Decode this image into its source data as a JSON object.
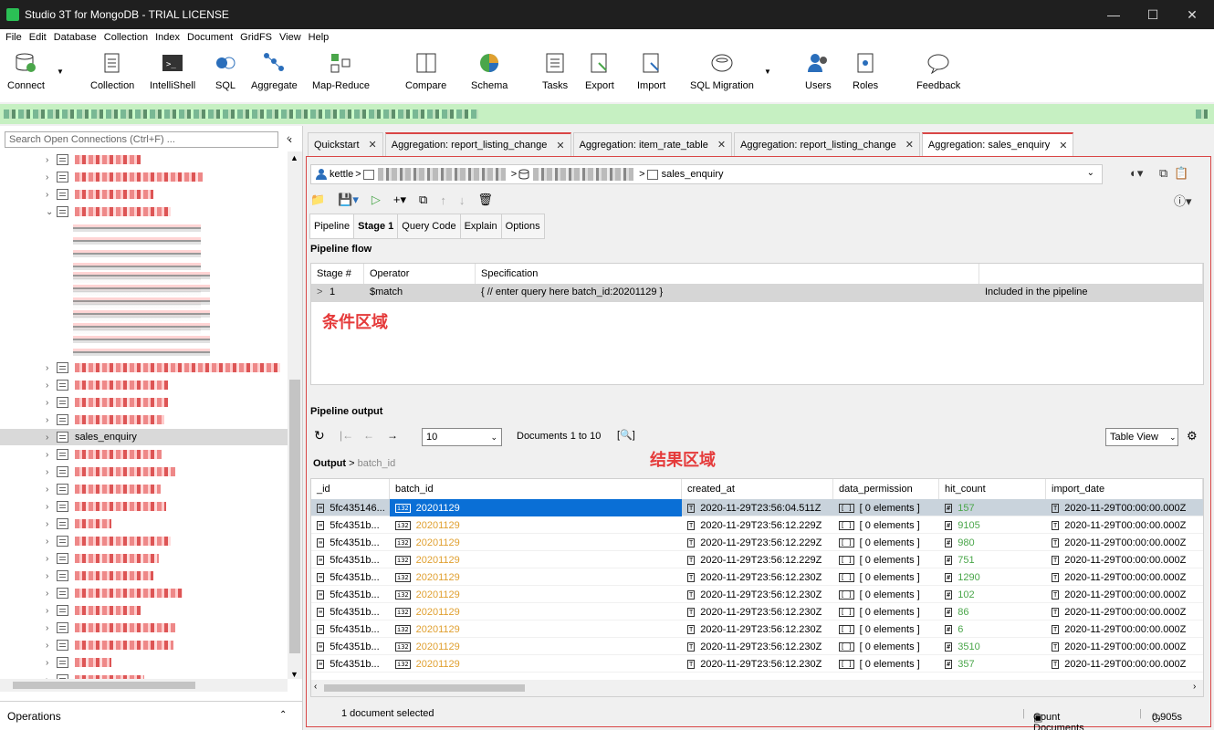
{
  "window": {
    "title": "Studio 3T for MongoDB - TRIAL LICENSE"
  },
  "menu": [
    "File",
    "Edit",
    "Database",
    "Collection",
    "Index",
    "Document",
    "GridFS",
    "View",
    "Help"
  ],
  "toolbar": [
    "Connect",
    "Collection",
    "IntelliShell",
    "SQL",
    "Aggregate",
    "Map-Reduce",
    "Compare",
    "Schema",
    "Tasks",
    "Export",
    "Import",
    "SQL Migration",
    "Users",
    "Roles",
    "Feedback"
  ],
  "left": {
    "search_placeholder": "Search Open Connections (Ctrl+F) ...",
    "selected_item": "sales_enquiry",
    "operations_label": "Operations"
  },
  "tabs": [
    "Quickstart",
    "Aggregation: report_listing_change",
    "Aggregation: item_rate_table",
    "Aggregation: report_listing_change",
    "Aggregation: sales_enquiry"
  ],
  "breadcrumb": {
    "user": "kettle",
    "collection": "sales_enquiry"
  },
  "subtabs": [
    "Pipeline",
    "Stage 1",
    "Query Code",
    "Explain",
    "Options"
  ],
  "pipeline_flow": {
    "heading": "Pipeline flow",
    "columns": [
      "Stage #",
      "Operator",
      "Specification"
    ],
    "row": {
      "stage": "1",
      "operator": "$match",
      "spec": "{ // enter query here batch_id:20201129 }",
      "status": "Included in the pipeline"
    },
    "annotation": "条件区域"
  },
  "pipeline_output": {
    "heading": "Pipeline output",
    "page_size": "10",
    "documents_label": "Documents 1 to 10",
    "view": "Table View",
    "annotation": "结果区域",
    "crumb_output": "Output",
    "crumb_field": "batch_id",
    "columns": [
      "_id",
      "batch_id",
      "created_at",
      "data_permission",
      "hit_count",
      "import_date"
    ],
    "rows": [
      {
        "id": "5fc435146...",
        "batch": "20201129",
        "created": "2020-11-29T23:56:04.511Z",
        "perm": "[ 0 elements ]",
        "hits": "157",
        "import": "2020-11-29T00:00:00.000Z"
      },
      {
        "id": "5fc4351b...",
        "batch": "20201129",
        "created": "2020-11-29T23:56:12.229Z",
        "perm": "[ 0 elements ]",
        "hits": "9105",
        "import": "2020-11-29T00:00:00.000Z"
      },
      {
        "id": "5fc4351b...",
        "batch": "20201129",
        "created": "2020-11-29T23:56:12.229Z",
        "perm": "[ 0 elements ]",
        "hits": "980",
        "import": "2020-11-29T00:00:00.000Z"
      },
      {
        "id": "5fc4351b...",
        "batch": "20201129",
        "created": "2020-11-29T23:56:12.229Z",
        "perm": "[ 0 elements ]",
        "hits": "751",
        "import": "2020-11-29T00:00:00.000Z"
      },
      {
        "id": "5fc4351b...",
        "batch": "20201129",
        "created": "2020-11-29T23:56:12.230Z",
        "perm": "[ 0 elements ]",
        "hits": "1290",
        "import": "2020-11-29T00:00:00.000Z"
      },
      {
        "id": "5fc4351b...",
        "batch": "20201129",
        "created": "2020-11-29T23:56:12.230Z",
        "perm": "[ 0 elements ]",
        "hits": "102",
        "import": "2020-11-29T00:00:00.000Z"
      },
      {
        "id": "5fc4351b...",
        "batch": "20201129",
        "created": "2020-11-29T23:56:12.230Z",
        "perm": "[ 0 elements ]",
        "hits": "86",
        "import": "2020-11-29T00:00:00.000Z"
      },
      {
        "id": "5fc4351b...",
        "batch": "20201129",
        "created": "2020-11-29T23:56:12.230Z",
        "perm": "[ 0 elements ]",
        "hits": "6",
        "import": "2020-11-29T00:00:00.000Z"
      },
      {
        "id": "5fc4351b...",
        "batch": "20201129",
        "created": "2020-11-29T23:56:12.230Z",
        "perm": "[ 0 elements ]",
        "hits": "3510",
        "import": "2020-11-29T00:00:00.000Z"
      },
      {
        "id": "5fc4351b...",
        "batch": "20201129",
        "created": "2020-11-29T23:56:12.230Z",
        "perm": "[ 0 elements ]",
        "hits": "357",
        "import": "2020-11-29T00:00:00.000Z"
      }
    ]
  },
  "status": {
    "selected": "1 document selected",
    "count_btn": "Count Documents",
    "time": "0.905s"
  },
  "colors": {
    "accent_red": "#d94646",
    "annotation_red": "#e53a3a",
    "selection_blue": "#0a6fd6",
    "batch_orange": "#e0a030",
    "number_green": "#4aa64a"
  }
}
